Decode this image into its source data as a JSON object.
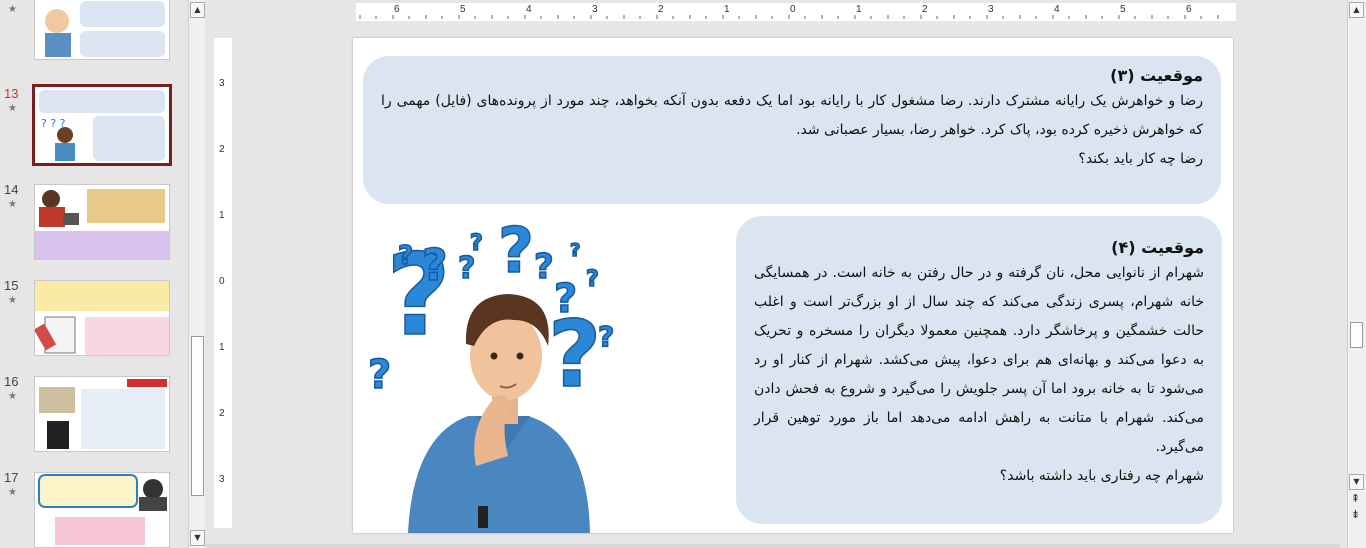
{
  "thumbnails": [
    {
      "number": "",
      "starred": true
    },
    {
      "number": "13",
      "starred": true,
      "selected": true
    },
    {
      "number": "14",
      "starred": true
    },
    {
      "number": "15",
      "starred": true
    },
    {
      "number": "16",
      "starred": true
    },
    {
      "number": "17",
      "starred": true
    }
  ],
  "thumb_star_glyph": "★",
  "scroll": {
    "up": "▲",
    "down": "▼",
    "prev_slide": "⇞",
    "next_slide": "⇟"
  },
  "ruler": {
    "h_labels": [
      "6",
      "5",
      "4",
      "3",
      "2",
      "1",
      "0",
      "1",
      "2",
      "3",
      "4",
      "5",
      "6"
    ],
    "v_labels": [
      "3",
      "2",
      "1",
      "0",
      "1",
      "2",
      "3"
    ]
  },
  "slide": {
    "situation3": {
      "title": "موقعیت (۳)",
      "paragraph": "رضا و خواهرش یک رایانه مشترک دارند. رضا مشغول کار با رایانه بود اما یک دفعه بدون آنکه بخواهد، چند مورد از پرونده‌های (فایل) مهمی را که خواهرش ذخیره کرده بود، پاک کرد. خواهر رضا، بسیار عصبانی شد.",
      "question": "رضا چه کار باید بکند؟"
    },
    "situation4": {
      "title": "موقعیت (۴)",
      "paragraph": "شهرام از نانوایی محل، نان گرفته و در حال رفتن به خانه است. در همسایگی خانه شهرام، پسری زندگی می‌کند که چند سال از او بزرگ‌تر است و اغلب حالت خشمگین و پرخاشگر دارد. همچنین معمولا دیگران را مسخره و تحریک به دعوا می‌کند و بهانه‌ای هم برای دعوا، پیش می‌کشد. شهرام از کنار او رد می‌شود تا به خانه برود اما آن پسر جلویش را می‌گیرد و شروع به فحش دادن می‌کند. شهرام با متانت به راهش ادامه می‌دهد اما باز مورد توهین قرار می‌گیرد.",
      "question": "شهرام چه رفتاری باید داشته باشد؟"
    },
    "image_icon": "thinking-boy-question-marks"
  },
  "colors": {
    "box": "#dbe5f1",
    "selected_border": "#7b1e1e",
    "selected_number": "#c0392b"
  }
}
